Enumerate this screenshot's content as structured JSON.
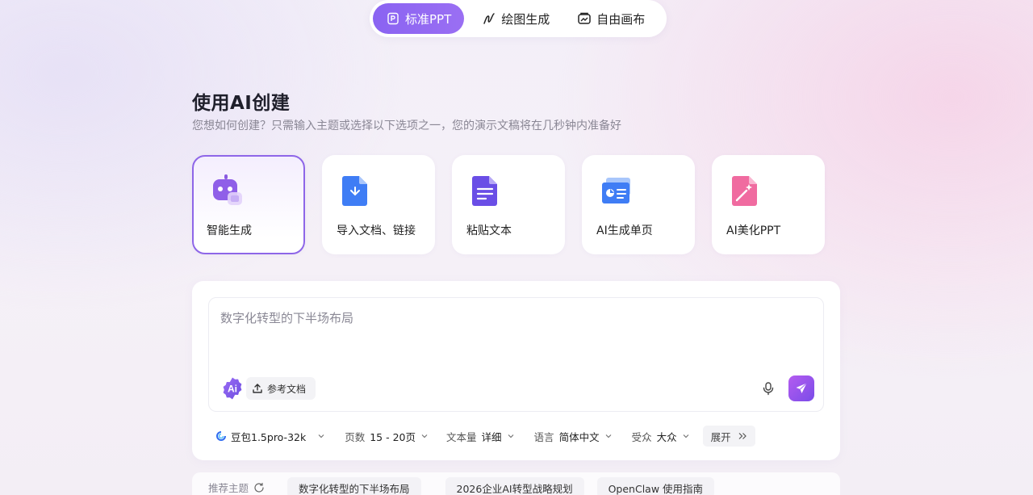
{
  "mode_tabs": [
    {
      "label": "标准PPT",
      "icon": "ppt-icon",
      "active": true
    },
    {
      "label": "绘图生成",
      "icon": "pen-draw-icon",
      "active": false
    },
    {
      "label": "自由画布",
      "icon": "canvas-icon",
      "active": false
    }
  ],
  "header": {
    "title": "使用AI创建",
    "subtitle": "您想如何创建？只需输入主题或选择以下选项之一，您的演示文稿将在几秒钟内准备好"
  },
  "create_options": [
    {
      "label": "智能生成",
      "icon": "robot-icon",
      "selected": true
    },
    {
      "label": "导入文档、链接",
      "icon": "import-document-icon",
      "selected": false
    },
    {
      "label": "粘贴文本",
      "icon": "paste-text-icon",
      "selected": false
    },
    {
      "label": "AI生成单页",
      "icon": "single-page-icon",
      "selected": false
    },
    {
      "label": "AI美化PPT",
      "icon": "beautify-wand-icon",
      "selected": false
    }
  ],
  "prompt": {
    "placeholder": "数字化转型的下半场布局",
    "value": "",
    "ai_badge": "Ai",
    "reference_button": "参考文档"
  },
  "options": {
    "model": "豆包1.5pro-32k",
    "pages_label": "页数",
    "pages_value": "15 - 20页",
    "text_label": "文本量",
    "text_value": "详细",
    "language_label": "语言",
    "language_value": "简体中文",
    "audience_label": "受众",
    "audience_value": "大众",
    "expand_label": "展开"
  },
  "recommendations": {
    "label": "推荐主题",
    "topics": [
      "数字化转型的下半场布局",
      "2026企业AI转型战略规划",
      "OpenClaw 使用指南"
    ]
  },
  "colors": {
    "accent": "#8a63f2",
    "send_gradient_start": "#b45cf0",
    "send_gradient_end": "#7a4ce8"
  }
}
